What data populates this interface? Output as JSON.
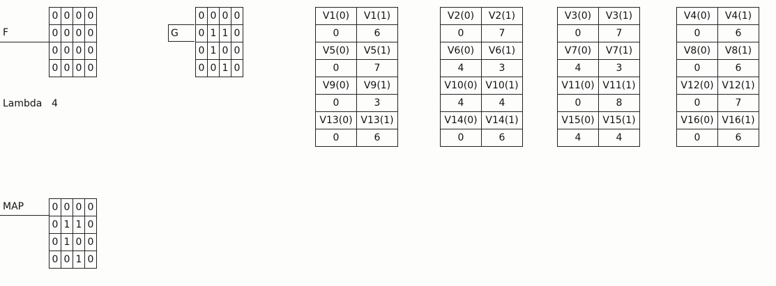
{
  "f_matrix": {
    "label": "F",
    "rows": [
      [
        "0",
        "0",
        "0",
        "0"
      ],
      [
        "0",
        "0",
        "0",
        "0"
      ],
      [
        "0",
        "0",
        "0",
        "0"
      ],
      [
        "0",
        "0",
        "0",
        "0"
      ]
    ]
  },
  "g_matrix": {
    "label": "G",
    "rows": [
      [
        "0",
        "0",
        "0",
        "0"
      ],
      [
        "0",
        "1",
        "1",
        "0"
      ],
      [
        "0",
        "1",
        "0",
        "0"
      ],
      [
        "0",
        "0",
        "1",
        "0"
      ]
    ]
  },
  "map_matrix": {
    "label": "MAP",
    "rows": [
      [
        "0",
        "0",
        "0",
        "0"
      ],
      [
        "0",
        "1",
        "1",
        "0"
      ],
      [
        "0",
        "1",
        "0",
        "0"
      ],
      [
        "0",
        "0",
        "1",
        "0"
      ]
    ]
  },
  "lambda": {
    "label": "Lambda",
    "value": "4"
  },
  "v_tables": [
    {
      "rows": [
        [
          "V1(0)",
          "V1(1)"
        ],
        [
          "0",
          "6"
        ],
        [
          "V5(0)",
          "V5(1)"
        ],
        [
          "0",
          "7"
        ],
        [
          "V9(0)",
          "V9(1)"
        ],
        [
          "0",
          "3"
        ],
        [
          "V13(0)",
          "V13(1)"
        ],
        [
          "0",
          "6"
        ]
      ]
    },
    {
      "rows": [
        [
          "V2(0)",
          "V2(1)"
        ],
        [
          "0",
          "7"
        ],
        [
          "V6(0)",
          "V6(1)"
        ],
        [
          "4",
          "3"
        ],
        [
          "V10(0)",
          "V10(1)"
        ],
        [
          "4",
          "4"
        ],
        [
          "V14(0)",
          "V14(1)"
        ],
        [
          "0",
          "6"
        ]
      ]
    },
    {
      "rows": [
        [
          "V3(0)",
          "V3(1)"
        ],
        [
          "0",
          "7"
        ],
        [
          "V7(0)",
          "V7(1)"
        ],
        [
          "4",
          "3"
        ],
        [
          "V11(0)",
          "V11(1)"
        ],
        [
          "0",
          "8"
        ],
        [
          "V15(0)",
          "V15(1)"
        ],
        [
          "4",
          "4"
        ]
      ]
    },
    {
      "rows": [
        [
          "V4(0)",
          "V4(1)"
        ],
        [
          "0",
          "6"
        ],
        [
          "V8(0)",
          "V8(1)"
        ],
        [
          "0",
          "6"
        ],
        [
          "V12(0)",
          "V12(1)"
        ],
        [
          "0",
          "7"
        ],
        [
          "V16(0)",
          "V16(1)"
        ],
        [
          "0",
          "6"
        ]
      ]
    }
  ]
}
